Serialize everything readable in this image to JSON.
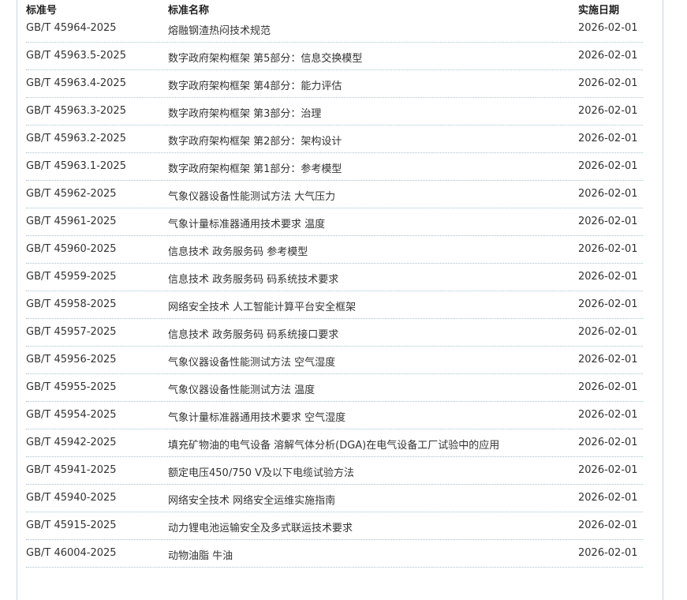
{
  "table": {
    "headers": {
      "code": "标准号",
      "name": "标准名称",
      "date": "实施日期"
    },
    "rows": [
      {
        "code": "GB/T 45964-2025",
        "name": "熔融钢渣热闷技术规范",
        "date": "2026-02-01"
      },
      {
        "code": "GB/T 45963.5-2025",
        "name": "数字政府架构框架 第5部分：信息交换模型",
        "date": "2026-02-01"
      },
      {
        "code": "GB/T 45963.4-2025",
        "name": "数字政府架构框架 第4部分：能力评估",
        "date": "2026-02-01"
      },
      {
        "code": "GB/T 45963.3-2025",
        "name": "数字政府架构框架 第3部分：治理",
        "date": "2026-02-01"
      },
      {
        "code": "GB/T 45963.2-2025",
        "name": "数字政府架构框架 第2部分：架构设计",
        "date": "2026-02-01"
      },
      {
        "code": "GB/T 45963.1-2025",
        "name": "数字政府架构框架 第1部分：参考模型",
        "date": "2026-02-01"
      },
      {
        "code": "GB/T 45962-2025",
        "name": "气象仪器设备性能测试方法 大气压力",
        "date": "2026-02-01"
      },
      {
        "code": "GB/T 45961-2025",
        "name": "气象计量标准器通用技术要求 温度",
        "date": "2026-02-01"
      },
      {
        "code": "GB/T 45960-2025",
        "name": "信息技术 政务服务码 参考模型",
        "date": "2026-02-01"
      },
      {
        "code": "GB/T 45959-2025",
        "name": "信息技术 政务服务码 码系统技术要求",
        "date": "2026-02-01"
      },
      {
        "code": "GB/T 45958-2025",
        "name": "网络安全技术 人工智能计算平台安全框架",
        "date": "2026-02-01"
      },
      {
        "code": "GB/T 45957-2025",
        "name": "信息技术 政务服务码 码系统接口要求",
        "date": "2026-02-01"
      },
      {
        "code": "GB/T 45956-2025",
        "name": "气象仪器设备性能测试方法 空气湿度",
        "date": "2026-02-01"
      },
      {
        "code": "GB/T 45955-2025",
        "name": "气象仪器设备性能测试方法 温度",
        "date": "2026-02-01"
      },
      {
        "code": "GB/T 45954-2025",
        "name": "气象计量标准器通用技术要求 空气湿度",
        "date": "2026-02-01"
      },
      {
        "code": "GB/T 45942-2025",
        "name": "填充矿物油的电气设备 溶解气体分析(DGA)在电气设备工厂试验中的应用",
        "date": "2026-02-01"
      },
      {
        "code": "GB/T 45941-2025",
        "name": "额定电压450/750 V及以下电缆试验方法",
        "date": "2026-02-01"
      },
      {
        "code": "GB/T 45940-2025",
        "name": "网络安全技术 网络安全运维实施指南",
        "date": "2026-02-01"
      },
      {
        "code": "GB/T 45915-2025",
        "name": "动力锂电池运输安全及多式联运技术要求",
        "date": "2026-02-01"
      },
      {
        "code": "GB/T 46004-2025",
        "name": "动物油脂 牛油",
        "date": "2026-02-01"
      }
    ]
  }
}
